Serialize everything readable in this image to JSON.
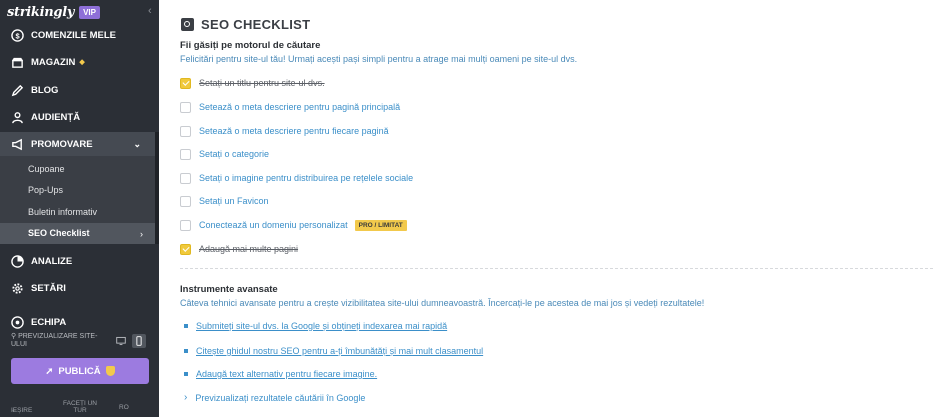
{
  "sidebar": {
    "logo": "strikingly",
    "vip_badge": "VIP",
    "nav": {
      "orders": "COMENZILE MELE",
      "store": "MAGAZIN",
      "blog": "BLOG",
      "audience": "AUDIENȚĂ",
      "promote": "PROMOVARE",
      "analytics": "ANALIZE",
      "settings": "SETĂRI",
      "team": "ECHIPA"
    },
    "promote_sub": [
      "Cupoane",
      "Pop-Ups",
      "Buletin informativ",
      "SEO Checklist"
    ],
    "preview_label": "PREVIZUALIZARE SITE-ULUI",
    "publish_label": "PUBLICĂ",
    "footer": {
      "exit": "IEȘIRE",
      "tour": "FACEȚI UN TUR",
      "lang": "RO"
    }
  },
  "main": {
    "title": "SEO CHECKLIST",
    "search_section": {
      "heading": "Fii găsiți pe motorul de căutare",
      "description": "Felicitări pentru site-ul tău! Urmați acești pași simpli pentru a atrage mai mulți oameni pe site-ul dvs.",
      "items": [
        {
          "label": "Setați un titlu pentru site-ul dvs.",
          "checked": true
        },
        {
          "label": "Setează o meta descriere pentru pagină principală",
          "checked": false
        },
        {
          "label": "Setează o meta descriere pentru fiecare pagină",
          "checked": false
        },
        {
          "label": "Setați o categorie",
          "checked": false
        },
        {
          "label": "Setați o imagine pentru distribuirea pe rețelele sociale",
          "checked": false
        },
        {
          "label": "Setați un Favicon",
          "checked": false
        },
        {
          "label": "Conectează un domeniu personalizat",
          "checked": false,
          "badge": "PRO / LIMITAT"
        },
        {
          "label": "Adaugă mai multe pagini",
          "checked": true
        }
      ]
    },
    "advanced_section": {
      "heading": "Instrumente avansate",
      "description": "Câteva tehnici avansate pentru a crește vizibilitatea site-ului dumneavoastră. Încercați-le pe acestea de mai jos și vedeți rezultatele!",
      "links": [
        "Submiteți site-ul dvs. la Google și obțineți indexarea mai rapidă",
        "Citește ghidul nostru SEO pentru a-ți îmbunătăți și mai mult clasamentul",
        "Adaugă text alternativ pentru fiecare imagine."
      ],
      "expand_label": "Previzualizați rezultatele căutării în Google"
    }
  },
  "colors": {
    "sidebar_bg": "#2b2f36",
    "accent_purple": "#9c7be0",
    "checkbox_checked": "#f0c93c",
    "link_blue": "#3b8fc9"
  }
}
